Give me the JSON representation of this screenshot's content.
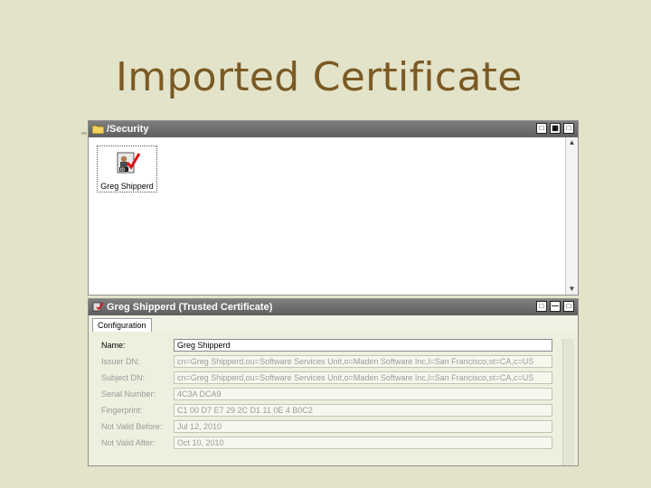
{
  "slide": {
    "title": "Imported Certificate"
  },
  "top_window": {
    "title": "/Security",
    "items": [
      {
        "label": "Greg Shipperd",
        "icon": "certificate-icon"
      }
    ]
  },
  "bottom_window": {
    "title": "Greg Shipperd (Trusted Certificate)",
    "tabs": [
      {
        "label": "Configuration"
      }
    ],
    "fields": [
      {
        "label": "Name:",
        "value": "Greg Shipperd"
      },
      {
        "label": "Issuer DN:",
        "value": "cn=Greg Shipperd,ou=Software Services Unit,o=Maden Software Inc,l=San Francisco,st=CA,c=US"
      },
      {
        "label": "Subject DN:",
        "value": "cn=Greg Shipperd,ou=Software Services Unit,o=Maden Software Inc,l=San Francisco,st=CA,c=US"
      },
      {
        "label": "Serial Number:",
        "value": "4C3A DCA9"
      },
      {
        "label": "Fingerprint:",
        "value": "C1 00 D7 E7 29 2C D1 11 0E 4 B0C2"
      },
      {
        "label": "Not Valid Before:",
        "value": "Jul 12, 2010"
      },
      {
        "label": "Not Valid After:",
        "value": "Oct 10, 2010"
      }
    ]
  },
  "colors": {
    "title_text": "#7b5a24",
    "background": "#e3e3c9",
    "titlebar": "#6a6a6a"
  }
}
